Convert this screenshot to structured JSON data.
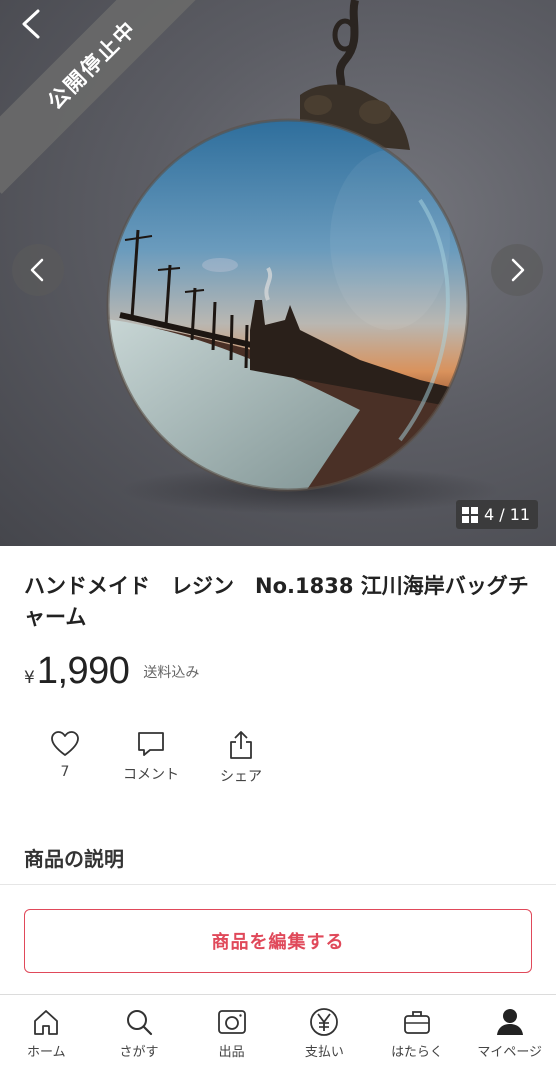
{
  "hero": {
    "ribbon_text": "公開停止中",
    "image_counter": "4 / 11",
    "icons": {
      "back": "chevron-left-icon",
      "prev": "chevron-left-icon",
      "next": "chevron-right-icon",
      "counter": "grid-icon"
    }
  },
  "product": {
    "title": "ハンドメイド　レジン　No.1838 江川海岸バッグチャーム",
    "currency": "¥",
    "price": "1,990",
    "shipping": "送料込み"
  },
  "actions": [
    {
      "icon": "heart-icon",
      "label": "7"
    },
    {
      "icon": "comment-icon",
      "label": "コメント"
    },
    {
      "icon": "share-icon",
      "label": "シェア"
    }
  ],
  "description": {
    "heading": "商品の説明"
  },
  "edit_button": {
    "label": "商品を編集する",
    "color": "#e0495a"
  },
  "tabbar": [
    {
      "icon": "home-icon",
      "label": "ホーム"
    },
    {
      "icon": "search-icon",
      "label": "さがす"
    },
    {
      "icon": "camera-icon",
      "label": "出品"
    },
    {
      "icon": "yen-icon",
      "label": "支払い"
    },
    {
      "icon": "briefcase-icon",
      "label": "はたらく"
    },
    {
      "icon": "person-icon",
      "label": "マイページ"
    }
  ]
}
